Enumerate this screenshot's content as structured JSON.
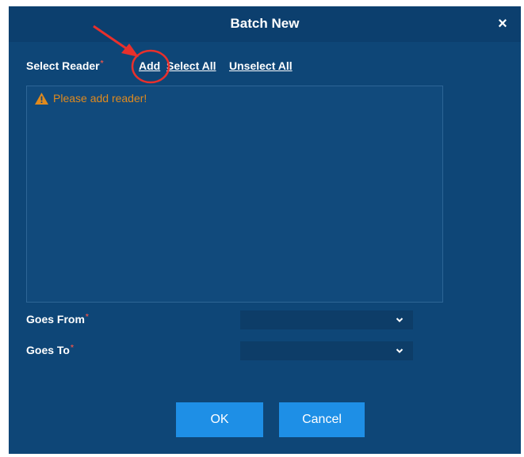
{
  "dialog": {
    "title": "Batch New",
    "close_label": "×"
  },
  "reader": {
    "label": "Select Reader",
    "required_mark": "*",
    "add_link": "Add",
    "select_all_link": "Select All",
    "unselect_all_link": "Unselect All",
    "warning_text": "Please add reader!"
  },
  "goes_from": {
    "label": "Goes From",
    "required_mark": "*",
    "value": ""
  },
  "goes_to": {
    "label": "Goes To",
    "required_mark": "*",
    "value": ""
  },
  "buttons": {
    "ok": "OK",
    "cancel": "Cancel"
  },
  "colors": {
    "dialog_bg": "#0e4677",
    "titlebar_bg": "#0c3f6e",
    "button_bg": "#1e8fe6",
    "warning": "#e08a1e",
    "annotation": "#e8302c"
  }
}
